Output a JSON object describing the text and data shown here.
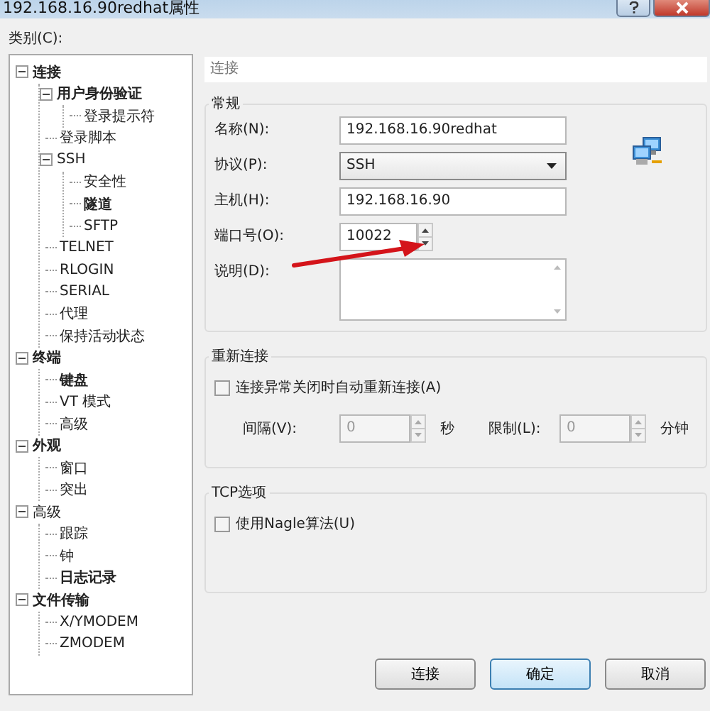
{
  "window": {
    "title": "192.168.16.90redhat属性"
  },
  "category_label": "类别(C):",
  "tree": [
    {
      "label": "连接",
      "bold": true,
      "expanded": true,
      "children": [
        {
          "label": "用户身份验证",
          "bold": true,
          "expanded": true,
          "children": [
            {
              "label": "登录提示符",
              "bold": false
            }
          ]
        },
        {
          "label": "登录脚本",
          "bold": false
        },
        {
          "label": "SSH",
          "bold": false,
          "expanded": true,
          "children": [
            {
              "label": "安全性",
              "bold": false
            },
            {
              "label": "隧道",
              "bold": true
            },
            {
              "label": "SFTP",
              "bold": false
            }
          ]
        },
        {
          "label": "TELNET",
          "bold": false
        },
        {
          "label": "RLOGIN",
          "bold": false
        },
        {
          "label": "SERIAL",
          "bold": false
        },
        {
          "label": "代理",
          "bold": false
        },
        {
          "label": "保持活动状态",
          "bold": false
        }
      ]
    },
    {
      "label": "终端",
      "bold": true,
      "expanded": true,
      "children": [
        {
          "label": "键盘",
          "bold": true
        },
        {
          "label": "VT 模式",
          "bold": false
        },
        {
          "label": "高级",
          "bold": false
        }
      ]
    },
    {
      "label": "外观",
      "bold": true,
      "expanded": true,
      "children": [
        {
          "label": "窗口",
          "bold": false
        },
        {
          "label": "突出",
          "bold": false
        }
      ]
    },
    {
      "label": "高级",
      "bold": false,
      "expanded": true,
      "children": [
        {
          "label": "跟踪",
          "bold": false
        },
        {
          "label": "钟",
          "bold": false
        },
        {
          "label": "日志记录",
          "bold": true
        }
      ]
    },
    {
      "label": "文件传输",
      "bold": true,
      "expanded": true,
      "children": [
        {
          "label": "X/YMODEM",
          "bold": false
        },
        {
          "label": "ZMODEM",
          "bold": false
        }
      ]
    }
  ],
  "header": "连接",
  "general": {
    "title": "常规",
    "fields": [
      {
        "kind": "text",
        "label": "名称(N):",
        "value": "192.168.16.90redhat"
      },
      {
        "kind": "select",
        "label": "协议(P):",
        "value": "SSH"
      },
      {
        "kind": "text",
        "label": "主机(H):",
        "value": "192.168.16.90"
      },
      {
        "kind": "spin",
        "label": "端口号(O):",
        "value": "10022"
      },
      {
        "kind": "textarea",
        "label": "说明(D):"
      }
    ]
  },
  "reconnect": {
    "title": "重新连接",
    "checkbox": {
      "label": "连接异常关闭时自动重新连接(A)",
      "checked": false
    },
    "spins": [
      {
        "label": "间隔(V):",
        "value": "0",
        "unit": "秒",
        "disabled": true
      },
      {
        "label": "限制(L):",
        "value": "0",
        "unit": "分钟",
        "disabled": true
      }
    ]
  },
  "tcp": {
    "title": "TCP选项",
    "checkbox": {
      "label": "使用Nagle算法(U)",
      "checked": false
    }
  },
  "buttons": [
    {
      "label": "连接",
      "default": false
    },
    {
      "label": "确定",
      "default": true
    },
    {
      "label": "取消",
      "default": false
    }
  ]
}
